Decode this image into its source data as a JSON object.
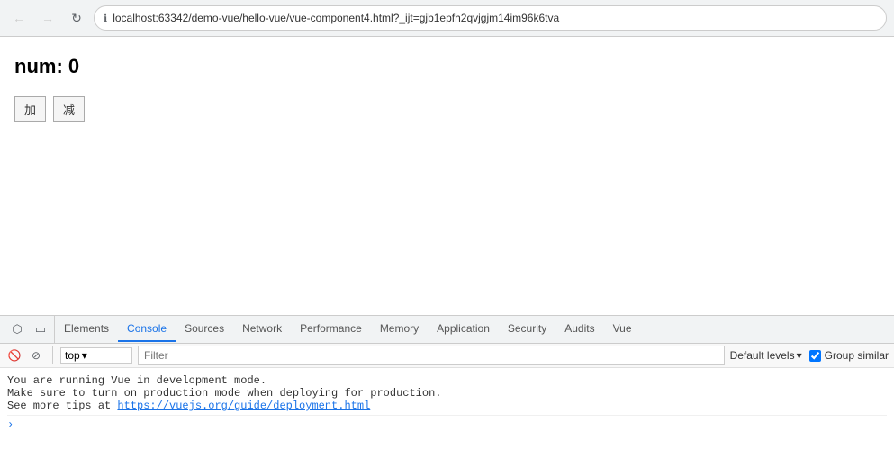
{
  "browser": {
    "back_label": "←",
    "forward_label": "→",
    "refresh_label": "↻",
    "url": "localhost:63342/demo-vue/hello-vue/vue-component4.html?_ijt=gjb1epfh2qvjgjm14im96k6tva",
    "lock_icon": "🔒"
  },
  "page": {
    "num_label": "num: 0",
    "btn_add": "加",
    "btn_sub": "减"
  },
  "devtools": {
    "tabs": [
      {
        "label": "Elements",
        "active": false
      },
      {
        "label": "Console",
        "active": true
      },
      {
        "label": "Sources",
        "active": false
      },
      {
        "label": "Network",
        "active": false
      },
      {
        "label": "Performance",
        "active": false
      },
      {
        "label": "Memory",
        "active": false
      },
      {
        "label": "Application",
        "active": false
      },
      {
        "label": "Security",
        "active": false
      },
      {
        "label": "Audits",
        "active": false
      },
      {
        "label": "Vue",
        "active": false
      }
    ]
  },
  "console": {
    "context_label": "top",
    "filter_placeholder": "Filter",
    "default_levels_label": "Default levels",
    "group_similar_label": "Group similar",
    "group_similar_checked": true,
    "messages": [
      {
        "text": "You are running Vue in development mode.",
        "line2": "Make sure to turn on production mode when deploying for production.",
        "line3_prefix": "See more tips at ",
        "link_text": "https://vuejs.org/guide/deployment.html",
        "link_url": "https://vuejs.org/guide/deployment.html"
      }
    ]
  }
}
